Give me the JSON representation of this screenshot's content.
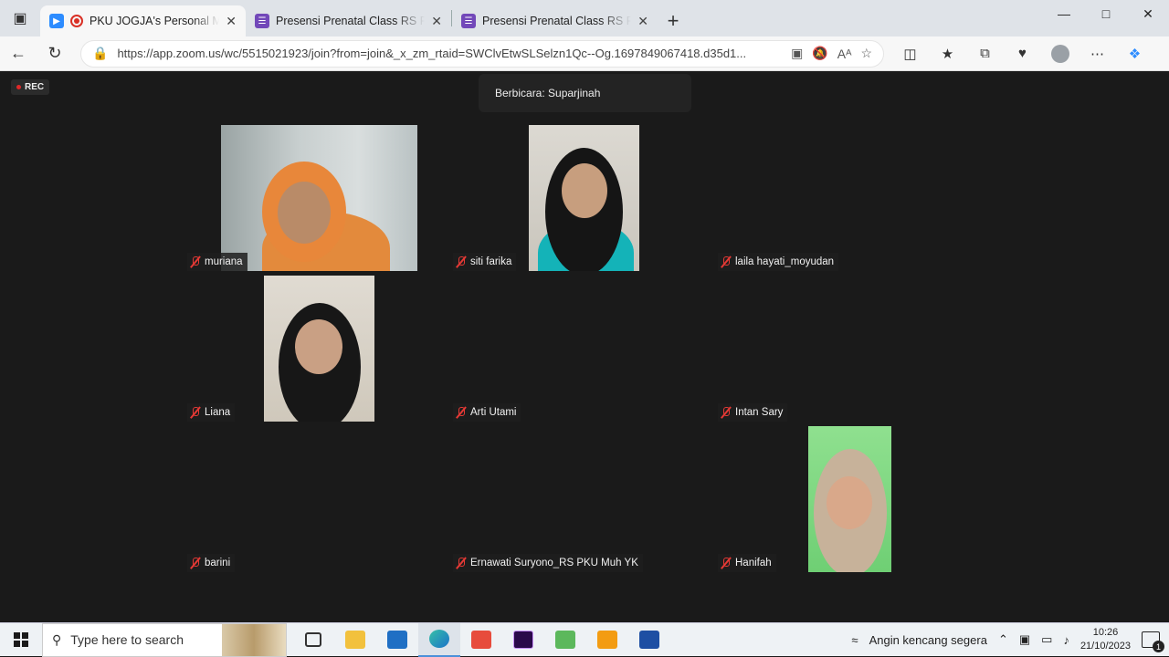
{
  "browser": {
    "tabs": [
      {
        "title": "PKU JOGJA's Personal Meeti",
        "active": true,
        "recording": true
      },
      {
        "title": "Presensi Prenatal Class RS PKU M",
        "active": false
      },
      {
        "title": "Presensi Prenatal Class RS PKU M",
        "active": false
      }
    ],
    "url": "https://app.zoom.us/wc/5515021923/join?from=join&_x_zm_rtaid=SWClvEtwSLSelzn1Qc--Og.1697849067418.d35d1...",
    "read_aloud": "Aᴬ"
  },
  "meeting": {
    "rec_label": "REC",
    "speaker_banner": "Berbicara: Suparjinah",
    "participants": [
      {
        "name": "muriana",
        "muted": true,
        "video": true
      },
      {
        "name": "siti farika",
        "muted": true,
        "video": true
      },
      {
        "name": "laila hayati_moyudan",
        "muted": true,
        "video": false
      },
      {
        "name": "Liana",
        "muted": true,
        "video": true
      },
      {
        "name": "Arti Utami",
        "muted": true,
        "video": false
      },
      {
        "name": "Intan Sary",
        "muted": true,
        "video": false
      },
      {
        "name": "barini",
        "muted": true,
        "video": false
      },
      {
        "name": "Ernawati Suryono_RS PKU Muh YK",
        "muted": true,
        "video": false
      },
      {
        "name": "Hanifah",
        "muted": true,
        "video": true
      }
    ]
  },
  "taskbar": {
    "search_placeholder": "Type here to search",
    "weather": "Angin kencang segera",
    "time": "10:26",
    "date": "21/10/2023",
    "notification_count": "1"
  }
}
